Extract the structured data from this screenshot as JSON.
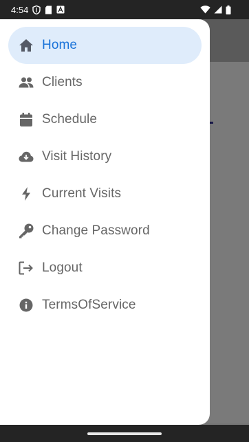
{
  "status_bar": {
    "time": "4:54",
    "left_icons": [
      "shield-icon",
      "sd-card-icon",
      "a-badge-icon"
    ],
    "right_icons": [
      "wifi-icon",
      "signal-icon",
      "battery-icon"
    ]
  },
  "drawer": {
    "items": [
      {
        "label": "Home",
        "icon": "home-icon",
        "active": true
      },
      {
        "label": "Clients",
        "icon": "people-icon",
        "active": false
      },
      {
        "label": "Schedule",
        "icon": "calendar-icon",
        "active": false
      },
      {
        "label": "Visit History",
        "icon": "cloud-download-icon",
        "active": false
      },
      {
        "label": "Current Visits",
        "icon": "bolt-icon",
        "active": false
      },
      {
        "label": "Change Password",
        "icon": "key-icon",
        "active": false
      },
      {
        "label": "Logout",
        "icon": "logout-icon",
        "active": false
      },
      {
        "label": "TermsOfService",
        "icon": "info-icon",
        "active": false
      }
    ]
  },
  "colors": {
    "accent": "#1a73d9",
    "active_background": "#dfecfb",
    "text": "#666666",
    "scrim": "#777777"
  }
}
